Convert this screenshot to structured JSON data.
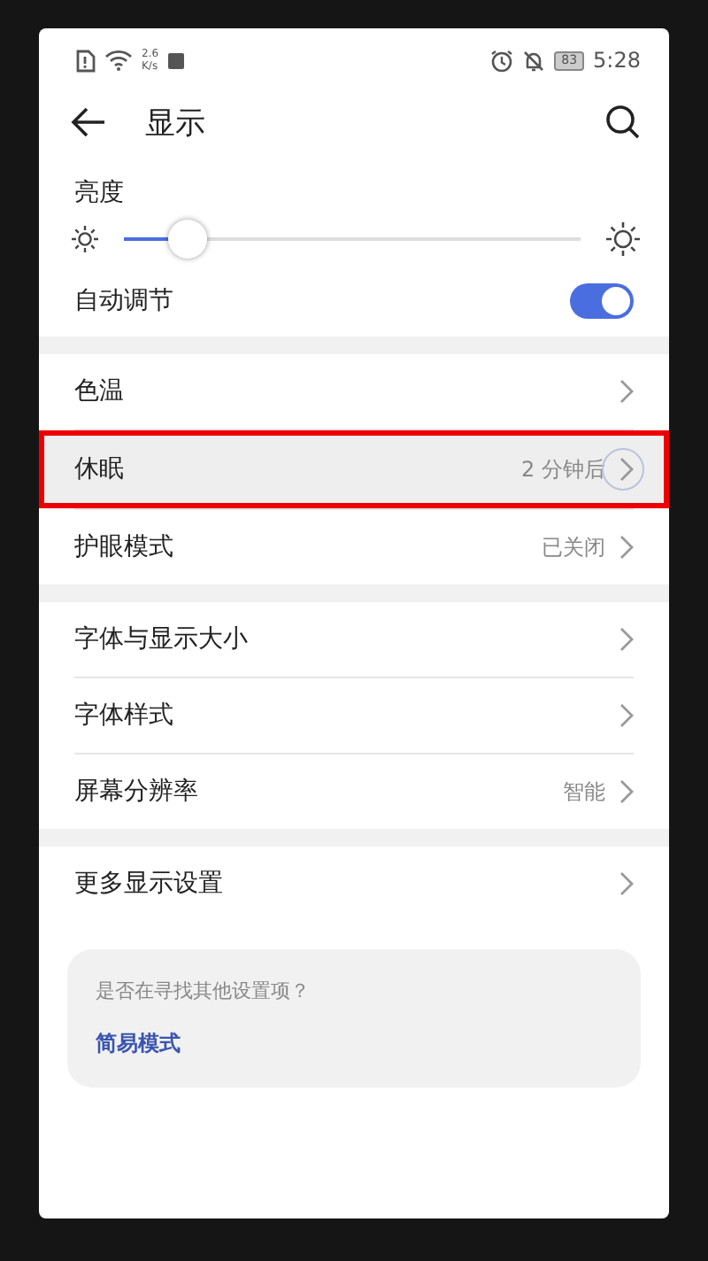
{
  "status_bar": {
    "speed_value": "2.6",
    "speed_unit": "K/s",
    "battery": "83",
    "time": "5:28"
  },
  "header": {
    "title": "显示"
  },
  "brightness": {
    "label": "亮度",
    "level": 0.14
  },
  "auto_adjust": {
    "label": "自动调节",
    "on": true
  },
  "sections": [
    {
      "rows": [
        {
          "label": "色温",
          "value": "",
          "selected": false
        },
        {
          "label": "休眠",
          "value": "2 分钟后",
          "selected": true
        },
        {
          "label": "护眼模式",
          "value": "已关闭",
          "selected": false
        }
      ]
    },
    {
      "rows": [
        {
          "label": "字体与显示大小",
          "selected": false
        },
        {
          "label": "字体样式",
          "selected": false
        },
        {
          "label": "屏幕分辨率",
          "value": "智能",
          "selected": false
        }
      ]
    },
    {
      "rows": [
        {
          "label": "更多显示设置",
          "selected": false
        }
      ]
    }
  ],
  "suggestion": {
    "question": "是否在寻找其他设置项？",
    "link": "简易模式"
  }
}
